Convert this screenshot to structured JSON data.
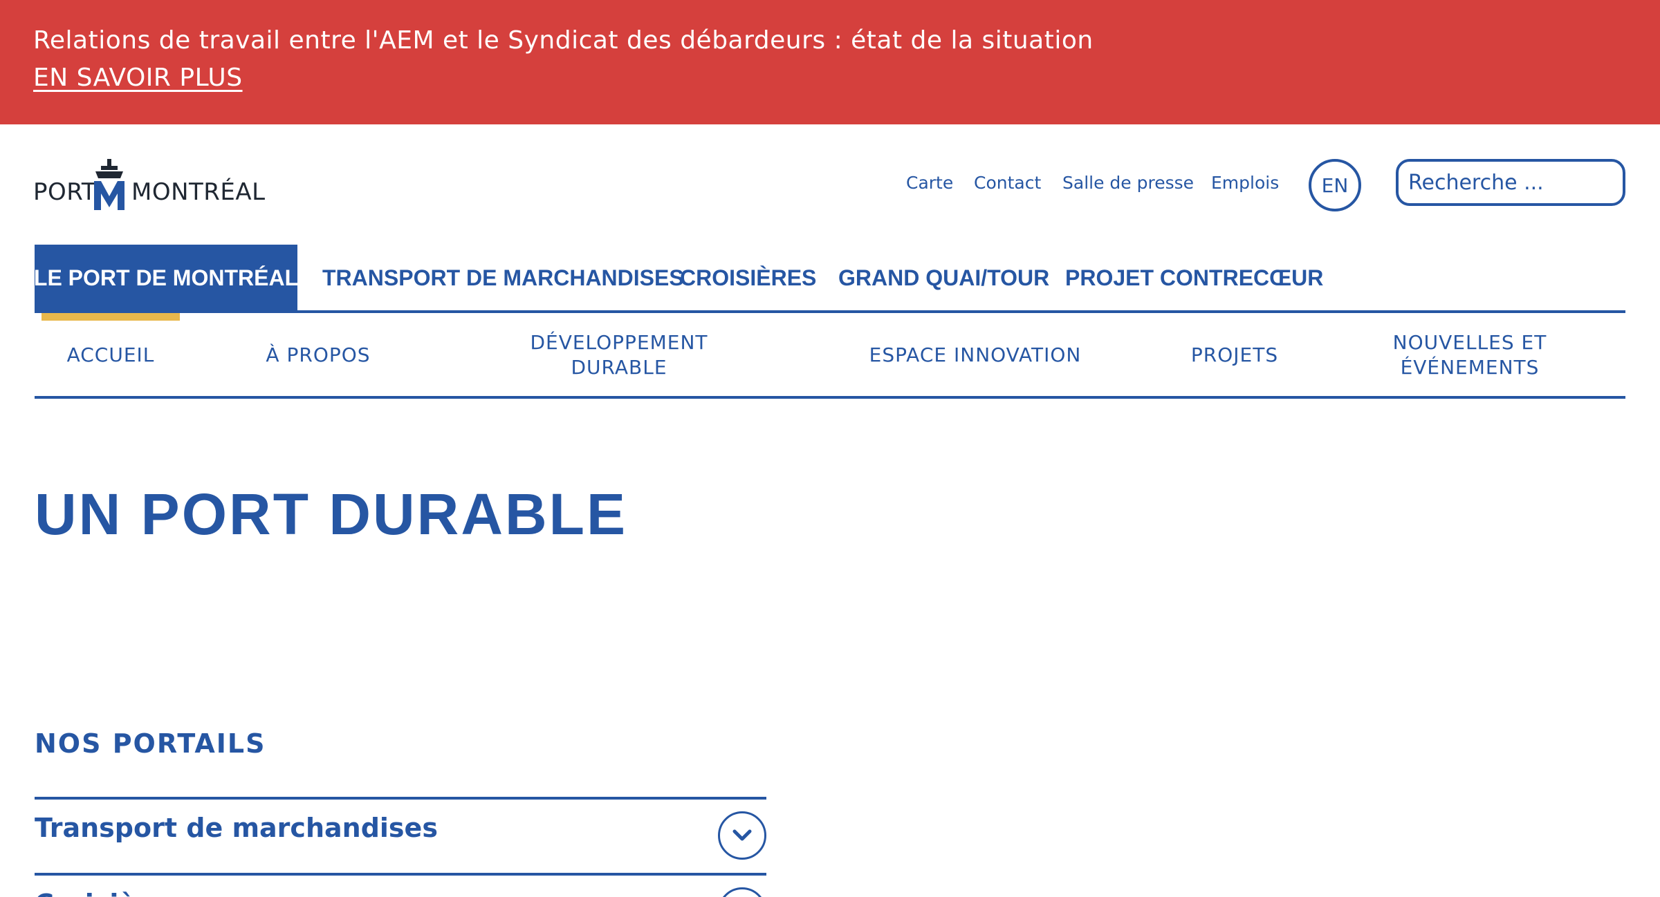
{
  "alert": {
    "message": "Relations de travail entre l'AEM et le Syndicat des débardeurs : état de la situation",
    "link_label": "EN SAVOIR PLUS"
  },
  "logo": {
    "left_text": "PORT",
    "right_text": "MONTRÉAL"
  },
  "utility_nav": {
    "items": [
      "Carte",
      "Contact",
      "Salle de presse",
      "Emplois"
    ],
    "language": "EN",
    "search_placeholder": "Recherche ..."
  },
  "main_nav": {
    "items": [
      "LE PORT DE MONTRÉAL",
      "TRANSPORT DE MARCHANDISES",
      "CROISIÈRES",
      "GRAND QUAI/TOUR",
      "PROJET CONTRECŒUR"
    ],
    "active": "LE PORT DE MONTRÉAL"
  },
  "sub_nav": {
    "items": [
      "ACCUEIL",
      "À PROPOS",
      "DÉVELOPPEMENT DURABLE",
      "ESPACE INNOVATION",
      "PROJETS",
      "NOUVELLES ET ÉVÉNEMENTS"
    ]
  },
  "page": {
    "title": "UN PORT DURABLE"
  },
  "portals": {
    "heading": "NOS PORTAILS",
    "items": [
      "Transport de marchandises",
      "Croisières"
    ]
  },
  "colors": {
    "alert_red": "#d5403d",
    "brand_blue": "#2656a3",
    "accent_gold": "#e8b84c"
  },
  "icons": {
    "toggle": "chevron-down-icon",
    "logo_mark": "ship-m-icon"
  }
}
